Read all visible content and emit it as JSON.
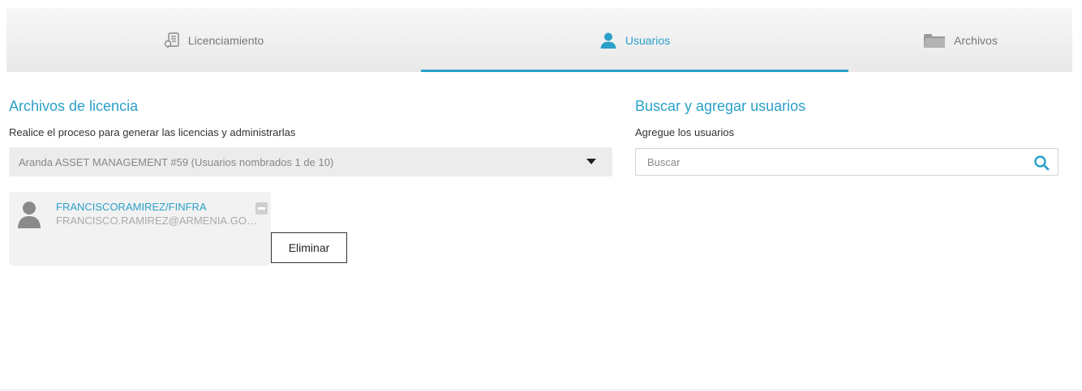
{
  "tabs": [
    {
      "label": "Licenciamiento",
      "icon": "license-file-icon",
      "active": false
    },
    {
      "label": "Usuarios",
      "icon": "user-icon",
      "active": true
    },
    {
      "label": "Archivos",
      "icon": "folder-icon",
      "active": false
    }
  ],
  "left": {
    "title": "Archivos de licencia",
    "subtitle": "Realice el proceso para generar las licencias y administrarlas",
    "select_value": "Aranda ASSET MANAGEMENT #59 (Usuarios nombrados 1 de 10)"
  },
  "right": {
    "title": "Buscar y agregar usuarios",
    "subtitle": "Agregue los usuarios",
    "search_placeholder": "Buscar"
  },
  "users": [
    {
      "name": "FRANCISCORAMIREZ/FINFRA",
      "email": "FRANCISCO.RAMIREZ@ARMENIA.GOV.CO"
    }
  ],
  "tooltip": "Eliminar",
  "colors": {
    "accent": "#2aa0c8",
    "card_bg": "#f2f2f2"
  }
}
